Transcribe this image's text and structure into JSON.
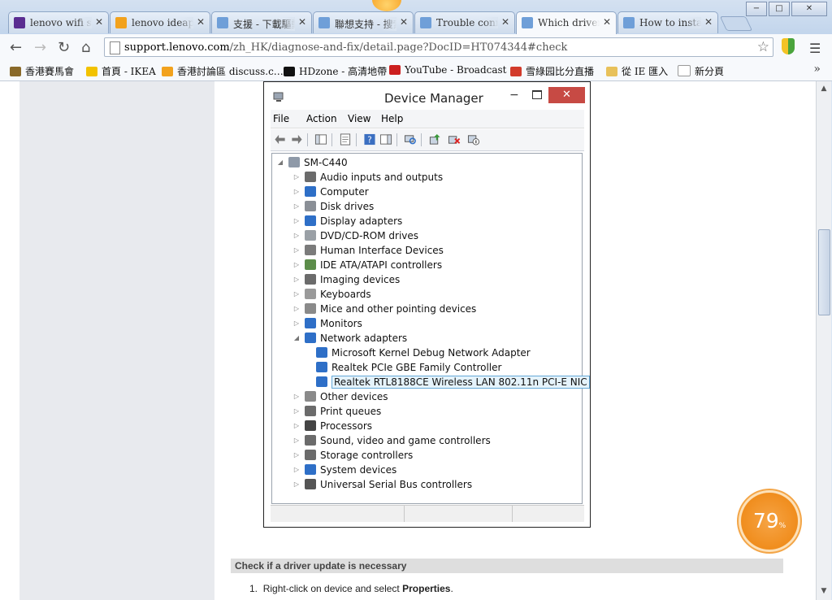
{
  "browser": {
    "tabs": [
      {
        "title": "lenovo wifi set",
        "favicon_color": "#5a2d91",
        "active": false
      },
      {
        "title": "lenovo ideapad",
        "favicon_color": "#f2a21d",
        "active": false
      },
      {
        "title": "支援 - 下載驅動",
        "favicon_color": "#6f9fd8",
        "active": false
      },
      {
        "title": "聯想支持 - 搜索",
        "favicon_color": "#6f9fd8",
        "active": false
      },
      {
        "title": "Trouble conne",
        "favicon_color": "#6f9fd8",
        "active": false
      },
      {
        "title": "Which driver s",
        "favicon_color": "#6f9fd8",
        "active": true
      },
      {
        "title": "How to install d",
        "favicon_color": "#6f9fd8",
        "active": false
      }
    ],
    "window_buttons": {
      "minimize": "−",
      "maximize": "□",
      "close": "✕"
    },
    "url_host": "support.lenovo.com",
    "url_path": "/zh_HK/diagnose-and-fix/detail.page?DocID=HT074344#check",
    "bookmarks": [
      {
        "label": "香港賽馬會",
        "icon_color": "#8a6a2a"
      },
      {
        "label": "首頁 - IKEA",
        "icon_color": "#f2c200"
      },
      {
        "label": "香港討論區 discuss.c…",
        "icon_color": "#f2a21d"
      },
      {
        "label": "HDzone - 高清地帶",
        "icon_color": "#111111"
      },
      {
        "label": "YouTube - Broadcast …",
        "icon_color": "#cc1f1f"
      },
      {
        "label": "雪綠园比分直播",
        "icon_color": "#d23b2b"
      },
      {
        "label": "從 IE 匯入",
        "icon_color": "#e8c15a"
      },
      {
        "label": "新分頁",
        "icon_color": "#ffffff"
      }
    ],
    "bookmarks_more": "»"
  },
  "snippet_top_text": "─ ─ ─ ─     ─ ─ ─",
  "device_manager": {
    "title": "Device Manager",
    "close": "✕",
    "minimize": "−",
    "menu": [
      "File",
      "Action",
      "View",
      "Help"
    ],
    "root": "SM-C440",
    "categories": [
      {
        "label": "Audio inputs and outputs",
        "icon_color": "#6b6b6b"
      },
      {
        "label": "Computer",
        "icon_color": "#2e6fc7"
      },
      {
        "label": "Disk drives",
        "icon_color": "#8a8f96"
      },
      {
        "label": "Display adapters",
        "icon_color": "#2e6fc7"
      },
      {
        "label": "DVD/CD-ROM drives",
        "icon_color": "#9aa0a6"
      },
      {
        "label": "Human Interface Devices",
        "icon_color": "#7b7b7b"
      },
      {
        "label": "IDE ATA/ATAPI controllers",
        "icon_color": "#5c8d4a"
      },
      {
        "label": "Imaging devices",
        "icon_color": "#6b6b6b"
      },
      {
        "label": "Keyboards",
        "icon_color": "#9a9a9a"
      },
      {
        "label": "Mice and other pointing devices",
        "icon_color": "#8a8a8a"
      },
      {
        "label": "Monitors",
        "icon_color": "#2e6fc7"
      },
      {
        "label": "Network adapters",
        "icon_color": "#2e6fc7"
      }
    ],
    "network_children": [
      {
        "label": "Microsoft Kernel Debug Network Adapter",
        "selected": false
      },
      {
        "label": "Realtek PCIe GBE Family Controller",
        "selected": false
      },
      {
        "label": "Realtek RTL8188CE Wireless LAN 802.11n PCI-E NIC",
        "selected": true
      }
    ],
    "categories_after": [
      {
        "label": "Other devices",
        "icon_color": "#8a8a8a"
      },
      {
        "label": "Print queues",
        "icon_color": "#6b6b6b"
      },
      {
        "label": "Processors",
        "icon_color": "#444444"
      },
      {
        "label": "Sound, video and game controllers",
        "icon_color": "#6b6b6b"
      },
      {
        "label": "Storage controllers",
        "icon_color": "#6b6b6b"
      },
      {
        "label": "System devices",
        "icon_color": "#2e6fc7"
      },
      {
        "label": "Universal Serial Bus controllers",
        "icon_color": "#555555"
      }
    ]
  },
  "article": {
    "section_title": "Check if a driver update is necessary",
    "step_number": "1.",
    "step_text": "Right-click on device and select ",
    "step_bold": "Properties",
    "step_end": "."
  },
  "score_badge": {
    "value": "79",
    "unit": "%"
  }
}
